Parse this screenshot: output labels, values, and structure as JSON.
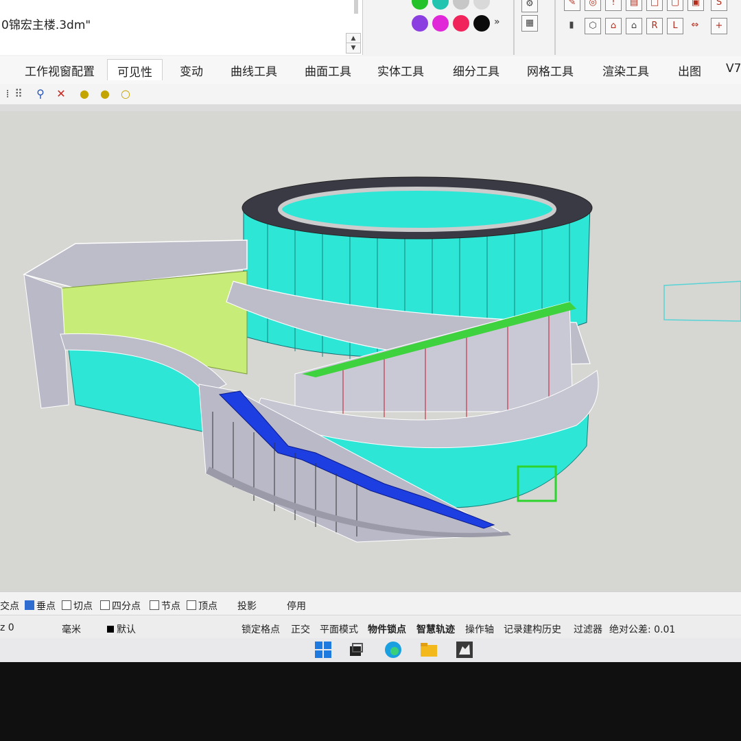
{
  "command": {
    "filename": "0锦宏主楼.3dm\"",
    "scroll_up": "▲",
    "scroll_down": "▼"
  },
  "swatches": [
    {
      "color": "#23c22a"
    },
    {
      "color": "#22c4b0"
    },
    {
      "color": "#c7c7c7"
    },
    {
      "color": "#d9d9d9"
    },
    {
      "color": "#8b3fe0"
    },
    {
      "color": "#e028d8"
    },
    {
      "color": "#f0235a"
    },
    {
      "color": "#0b0b0b"
    }
  ],
  "swatch_more": "»",
  "tabs": [
    {
      "label": "工作视窗配置",
      "active": false
    },
    {
      "label": "可见性",
      "active": true
    },
    {
      "label": "变动",
      "active": false
    },
    {
      "label": "曲线工具",
      "active": false
    },
    {
      "label": "曲面工具",
      "active": false
    },
    {
      "label": "实体工具",
      "active": false
    },
    {
      "label": "细分工具",
      "active": false
    },
    {
      "label": "网格工具",
      "active": false
    },
    {
      "label": "渲染工具",
      "active": false
    },
    {
      "label": "出图",
      "active": false
    },
    {
      "label": "V7",
      "active": false
    }
  ],
  "visibility_icons": [
    "grid-points-icon",
    "show-points-icon",
    "show-object-icon",
    "hide-object-icon",
    "light-bulb-on-icon",
    "light-bulb-icon",
    "light-bulb-off-icon"
  ],
  "osnap": {
    "items": [
      {
        "label": "交点",
        "checked": null
      },
      {
        "label": "垂点",
        "checked": true
      },
      {
        "label": "切点",
        "checked": false
      },
      {
        "label": "四分点",
        "checked": false
      },
      {
        "label": "节点",
        "checked": false
      },
      {
        "label": "顶点",
        "checked": false
      },
      {
        "label": "投影",
        "checked": false
      },
      {
        "label": "停用",
        "checked": false
      }
    ]
  },
  "status": {
    "coord": "z 0",
    "units": "毫米",
    "layer": "默认",
    "items": [
      {
        "label": "锁定格点",
        "bold": false
      },
      {
        "label": "正交",
        "bold": false
      },
      {
        "label": "平面模式",
        "bold": false
      },
      {
        "label": "物件锁点",
        "bold": true
      },
      {
        "label": "智慧轨迹",
        "bold": true
      },
      {
        "label": "操作轴",
        "bold": false
      },
      {
        "label": "记录建构历史",
        "bold": false
      },
      {
        "label": "过滤器",
        "bold": false
      }
    ],
    "tolerance": "绝对公差: 0.01"
  },
  "taskbar": [
    "windows-start-icon",
    "task-view-icon",
    "edge-browser-icon",
    "file-explorer-icon",
    "rhino-app-icon"
  ],
  "colors": {
    "cyan_facade": "#2ee6d6",
    "lime_facade": "#c8ec78",
    "slab_gray": "#b9b9c8",
    "stair_blue": "#1d3ee0",
    "roof_dark": "#3a3a44"
  }
}
